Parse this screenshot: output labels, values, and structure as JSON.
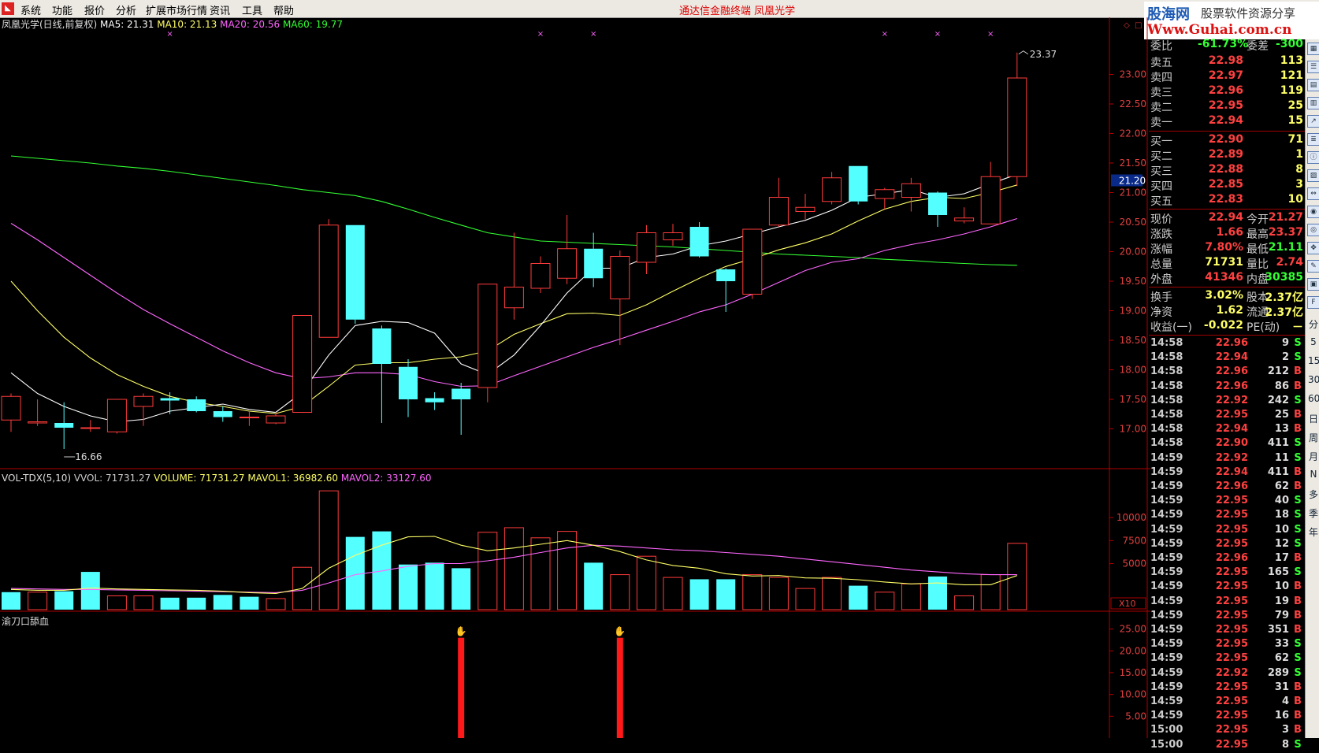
{
  "menubar": {
    "items": [
      "系统",
      "功能",
      "报价",
      "分析",
      "扩展市场行情",
      "资讯",
      "工具",
      "帮助"
    ],
    "center_title": "通达信金融终端    凤凰光学"
  },
  "watermark": {
    "line1": "股海网",
    "line2": "股票软件资源分享",
    "line3": "Www.Guhai.com.cn"
  },
  "chart_data": [
    {
      "type": "candlestick",
      "title": "凤凰光学(日线,前复权)",
      "ma_legend": [
        {
          "name": "MA5",
          "value": "21.31",
          "color": "#ffffff"
        },
        {
          "name": "MA10",
          "value": "21.13",
          "color": "#ffff66"
        },
        {
          "name": "MA20",
          "value": "20.56",
          "color": "#ff66ff"
        },
        {
          "name": "MA60",
          "value": "19.77",
          "color": "#33ff33"
        }
      ],
      "y_ticks": [
        "23.00",
        "22.50",
        "22.00",
        "21.50",
        "21.00",
        "20.50",
        "20.00",
        "19.50",
        "19.00",
        "18.50",
        "18.00",
        "17.50",
        "17.00"
      ],
      "ylim": [
        16.5,
        23.7
      ],
      "current_price_label": "21.20",
      "current_price": 21.2,
      "high_annotation": "23.37",
      "low_annotation": "16.66",
      "candles": [
        {
          "o": 17.15,
          "c": 17.55,
          "h": 17.6,
          "l": 16.95
        },
        {
          "o": 17.1,
          "c": 17.12,
          "h": 17.5,
          "l": 17.05
        },
        {
          "o": 17.1,
          "c": 17.02,
          "h": 17.45,
          "l": 16.66
        },
        {
          "o": 17.02,
          "c": 17.02,
          "h": 17.15,
          "l": 16.95
        },
        {
          "o": 16.95,
          "c": 17.5,
          "h": 17.5,
          "l": 16.92
        },
        {
          "o": 17.38,
          "c": 17.55,
          "h": 17.6,
          "l": 17.05
        },
        {
          "o": 17.52,
          "c": 17.48,
          "h": 17.62,
          "l": 17.25
        },
        {
          "o": 17.5,
          "c": 17.3,
          "h": 17.55,
          "l": 17.28
        },
        {
          "o": 17.3,
          "c": 17.2,
          "h": 17.38,
          "l": 17.12
        },
        {
          "o": 17.2,
          "c": 17.2,
          "h": 17.3,
          "l": 17.05
        },
        {
          "o": 17.1,
          "c": 17.22,
          "h": 17.28,
          "l": 17.08
        },
        {
          "o": 17.28,
          "c": 18.92,
          "h": 18.92,
          "l": 17.28
        },
        {
          "o": 18.55,
          "c": 20.45,
          "h": 20.55,
          "l": 18.55
        },
        {
          "o": 20.45,
          "c": 18.85,
          "h": 20.45,
          "l": 18.78
        },
        {
          "o": 18.7,
          "c": 18.1,
          "h": 18.75,
          "l": 17.1
        },
        {
          "o": 18.05,
          "c": 17.5,
          "h": 18.18,
          "l": 17.2
        },
        {
          "o": 17.52,
          "c": 17.45,
          "h": 17.62,
          "l": 17.32
        },
        {
          "o": 17.68,
          "c": 17.5,
          "h": 17.78,
          "l": 16.9
        },
        {
          "o": 17.7,
          "c": 19.45,
          "h": 19.45,
          "l": 17.45
        },
        {
          "o": 19.05,
          "c": 19.4,
          "h": 20.32,
          "l": 18.85
        },
        {
          "o": 19.38,
          "c": 19.8,
          "h": 19.92,
          "l": 19.3
        },
        {
          "o": 19.55,
          "c": 20.05,
          "h": 20.62,
          "l": 19.45
        },
        {
          "o": 20.05,
          "c": 19.55,
          "h": 20.32,
          "l": 19.4
        },
        {
          "o": 19.2,
          "c": 19.92,
          "h": 20.02,
          "l": 18.42
        },
        {
          "o": 19.82,
          "c": 20.32,
          "h": 20.45,
          "l": 19.62
        },
        {
          "o": 20.2,
          "c": 20.32,
          "h": 20.47,
          "l": 20.1
        },
        {
          "o": 20.42,
          "c": 19.92,
          "h": 20.5,
          "l": 19.9
        },
        {
          "o": 19.7,
          "c": 19.5,
          "h": 19.72,
          "l": 18.98
        },
        {
          "o": 19.28,
          "c": 20.38,
          "h": 20.38,
          "l": 19.2
        },
        {
          "o": 20.45,
          "c": 20.92,
          "h": 21.25,
          "l": 20.42
        },
        {
          "o": 20.68,
          "c": 20.75,
          "h": 20.98,
          "l": 20.55
        },
        {
          "o": 20.85,
          "c": 21.25,
          "h": 21.35,
          "l": 20.8
        },
        {
          "o": 21.45,
          "c": 20.85,
          "h": 21.45,
          "l": 20.8
        },
        {
          "o": 20.9,
          "c": 21.05,
          "h": 21.08,
          "l": 20.72
        },
        {
          "o": 20.92,
          "c": 21.15,
          "h": 21.25,
          "l": 20.68
        },
        {
          "o": 21.0,
          "c": 20.62,
          "h": 21.02,
          "l": 20.42
        },
        {
          "o": 20.52,
          "c": 20.57,
          "h": 20.75,
          "l": 20.48
        },
        {
          "o": 20.47,
          "c": 21.27,
          "h": 21.52,
          "l": 20.47
        },
        {
          "o": 21.27,
          "c": 22.94,
          "h": 23.37,
          "l": 21.11
        }
      ],
      "ma5": [
        17.95,
        17.6,
        17.38,
        17.22,
        17.12,
        17.16,
        17.3,
        17.36,
        17.42,
        17.33,
        17.28,
        17.62,
        18.25,
        18.75,
        18.82,
        18.8,
        18.62,
        18.1,
        17.92,
        18.25,
        18.75,
        19.3,
        19.72,
        19.72,
        19.9,
        19.96,
        20.1,
        20.18,
        20.3,
        20.42,
        20.53,
        20.7,
        20.92,
        20.98,
        21.05,
        20.92,
        20.98,
        21.15,
        21.31
      ],
      "ma10": [
        19.5,
        19.0,
        18.55,
        18.2,
        17.92,
        17.72,
        17.55,
        17.45,
        17.38,
        17.3,
        17.26,
        17.38,
        17.72,
        18.08,
        18.12,
        18.12,
        18.18,
        18.22,
        18.32,
        18.6,
        18.78,
        18.95,
        18.96,
        18.92,
        19.1,
        19.33,
        19.55,
        19.75,
        19.88,
        20.03,
        20.15,
        20.3,
        20.52,
        20.72,
        20.85,
        20.92,
        20.9,
        21.0,
        21.13
      ],
      "ma20": [
        20.48,
        20.2,
        19.9,
        19.6,
        19.3,
        19.02,
        18.78,
        18.55,
        18.32,
        18.12,
        17.95,
        17.85,
        17.88,
        17.95,
        17.95,
        17.92,
        17.8,
        17.72,
        17.73,
        17.9,
        18.06,
        18.22,
        18.38,
        18.52,
        18.67,
        18.82,
        18.98,
        19.1,
        19.28,
        19.48,
        19.68,
        19.82,
        19.88,
        20.02,
        20.12,
        20.2,
        20.3,
        20.42,
        20.56
      ],
      "ma60": [
        21.62,
        21.58,
        21.54,
        21.5,
        21.45,
        21.41,
        21.36,
        21.3,
        21.24,
        21.18,
        21.12,
        21.05,
        21.0,
        20.95,
        20.85,
        20.72,
        20.58,
        20.45,
        20.32,
        20.25,
        20.18,
        20.16,
        20.14,
        20.12,
        20.1,
        20.08,
        20.05,
        20.02,
        19.99,
        19.96,
        19.94,
        19.92,
        19.9,
        19.87,
        19.85,
        19.82,
        19.8,
        19.78,
        19.77
      ],
      "mark_indices": [
        6,
        20,
        22,
        33,
        35,
        37
      ]
    },
    {
      "type": "bar",
      "title": "VOL-TDX(5,10)",
      "legend": [
        {
          "name": "VVOL",
          "value": "71731.27",
          "color": "#cccccc"
        },
        {
          "name": "VOLUME",
          "value": "71731.27",
          "color": "#ffff66"
        },
        {
          "name": "MAVOL1",
          "value": "36982.60",
          "color": "#ffff66"
        },
        {
          "name": "MAVOL2",
          "value": "33127.60",
          "color": "#ff66ff"
        }
      ],
      "y_ticks": [
        "10000",
        "7500",
        "5000"
      ],
      "ylim": [
        0,
        13000
      ],
      "unit_label": "X10",
      "values": [
        1900,
        1900,
        2000,
        4100,
        1500,
        1500,
        1300,
        1300,
        1600,
        1400,
        1200,
        4600,
        12900,
        7900,
        8500,
        4900,
        5100,
        4500,
        8400,
        8900,
        7800,
        8500,
        5100,
        3800,
        5800,
        3500,
        3300,
        3300,
        3800,
        3500,
        2300,
        3500,
        2600,
        1900,
        2800,
        3600,
        1500,
        3800,
        7200
      ],
      "up": [
        false,
        true,
        false,
        false,
        true,
        true,
        false,
        false,
        false,
        false,
        true,
        true,
        true,
        false,
        false,
        false,
        false,
        false,
        true,
        true,
        true,
        true,
        false,
        true,
        true,
        true,
        false,
        false,
        true,
        true,
        true,
        true,
        false,
        true,
        true,
        false,
        true,
        true,
        true
      ],
      "mavol1": [
        2200,
        2100,
        2100,
        2350,
        2250,
        2200,
        2150,
        2100,
        2000,
        1850,
        1750,
        2300,
        4500,
        5900,
        7000,
        7900,
        7950,
        7000,
        6400,
        6700,
        7100,
        7500,
        7000,
        6300,
        5400,
        4800,
        4500,
        3900,
        3650,
        3700,
        3450,
        3400,
        3250,
        3000,
        2800,
        2900,
        2700,
        2700,
        3700
      ],
      "mavol2": [
        2300,
        2250,
        2200,
        2200,
        2150,
        2100,
        2050,
        2000,
        1950,
        1900,
        1850,
        2100,
        2900,
        3800,
        4200,
        4700,
        5000,
        5000,
        5300,
        5700,
        6200,
        6700,
        7000,
        6900,
        6700,
        6500,
        6400,
        6200,
        6000,
        5800,
        5500,
        5200,
        4900,
        4600,
        4300,
        4100,
        3900,
        3800,
        3800
      ]
    },
    {
      "type": "bar",
      "title": "渝刀口舔血",
      "y_ticks": [
        "25.00",
        "20.00",
        "15.00",
        "10.00",
        "5.00"
      ],
      "ylim": [
        0,
        28
      ],
      "signals": [
        {
          "index": 17,
          "value": 23
        },
        {
          "index": 23,
          "value": 23
        }
      ]
    }
  ],
  "quote": {
    "header": {
      "left": "委比",
      "left_value": "-61.73%",
      "right": "委差",
      "right_value": "-300"
    },
    "asks": [
      {
        "label": "卖五",
        "price": "22.98",
        "vol": "113"
      },
      {
        "label": "卖四",
        "price": "22.97",
        "vol": "121"
      },
      {
        "label": "卖三",
        "price": "22.96",
        "vol": "119"
      },
      {
        "label": "卖二",
        "price": "22.95",
        "vol": "25"
      },
      {
        "label": "卖一",
        "price": "22.94",
        "vol": "15"
      }
    ],
    "bids": [
      {
        "label": "买一",
        "price": "22.90",
        "vol": "71"
      },
      {
        "label": "买二",
        "price": "22.89",
        "vol": "1"
      },
      {
        "label": "买三",
        "price": "22.88",
        "vol": "8"
      },
      {
        "label": "买四",
        "price": "22.85",
        "vol": "3"
      },
      {
        "label": "买五",
        "price": "22.83",
        "vol": "10"
      }
    ],
    "stats": [
      {
        "l1": "现价",
        "v1": "22.94",
        "l2": "今开",
        "v2": "21.27",
        "c1": "#ff4040",
        "c2": "#ff4040"
      },
      {
        "l1": "涨跌",
        "v1": "1.66",
        "l2": "最高",
        "v2": "23.37",
        "c1": "#ff4040",
        "c2": "#ff4040"
      },
      {
        "l1": "涨幅",
        "v1": "7.80%",
        "l2": "最低",
        "v2": "21.11",
        "c1": "#ff4040",
        "c2": "#33ff33"
      },
      {
        "l1": "总量",
        "v1": "71731",
        "l2": "量比",
        "v2": "2.74",
        "c1": "#ffff66",
        "c2": "#ff4040"
      },
      {
        "l1": "外盘",
        "v1": "41346",
        "l2": "内盘",
        "v2": "30385",
        "c1": "#ff4040",
        "c2": "#33ff33"
      }
    ],
    "stats2": [
      {
        "l1": "换手",
        "v1": "3.02%",
        "l2": "股本",
        "v2": "2.37亿",
        "c1": "#ffff66",
        "c2": "#ffff66"
      },
      {
        "l1": "净资",
        "v1": "1.62",
        "l2": "流通",
        "v2": "2.37亿",
        "c1": "#ffff66",
        "c2": "#ffff66"
      },
      {
        "l1": "收益(一)",
        "v1": "-0.022",
        "l2": "PE(动)",
        "v2": "－",
        "c1": "#ffff66",
        "c2": "#ffff66"
      }
    ],
    "ticks": [
      {
        "t": "14:58",
        "p": "22.96",
        "v": "9",
        "d": "S"
      },
      {
        "t": "14:58",
        "p": "22.94",
        "v": "2",
        "d": "S"
      },
      {
        "t": "14:58",
        "p": "22.96",
        "v": "212",
        "d": "B"
      },
      {
        "t": "14:58",
        "p": "22.96",
        "v": "86",
        "d": "B"
      },
      {
        "t": "14:58",
        "p": "22.92",
        "v": "242",
        "d": "S"
      },
      {
        "t": "14:58",
        "p": "22.95",
        "v": "25",
        "d": "B"
      },
      {
        "t": "14:58",
        "p": "22.94",
        "v": "13",
        "d": "B"
      },
      {
        "t": "14:58",
        "p": "22.90",
        "v": "411",
        "d": "S"
      },
      {
        "t": "14:59",
        "p": "22.92",
        "v": "11",
        "d": "S"
      },
      {
        "t": "14:59",
        "p": "22.94",
        "v": "411",
        "d": "B"
      },
      {
        "t": "14:59",
        "p": "22.96",
        "v": "62",
        "d": "B"
      },
      {
        "t": "14:59",
        "p": "22.95",
        "v": "40",
        "d": "S"
      },
      {
        "t": "14:59",
        "p": "22.95",
        "v": "18",
        "d": "S"
      },
      {
        "t": "14:59",
        "p": "22.95",
        "v": "10",
        "d": "S"
      },
      {
        "t": "14:59",
        "p": "22.95",
        "v": "12",
        "d": "S"
      },
      {
        "t": "14:59",
        "p": "22.96",
        "v": "17",
        "d": "B"
      },
      {
        "t": "14:59",
        "p": "22.95",
        "v": "165",
        "d": "S"
      },
      {
        "t": "14:59",
        "p": "22.95",
        "v": "10",
        "d": "B"
      },
      {
        "t": "14:59",
        "p": "22.95",
        "v": "19",
        "d": "B"
      },
      {
        "t": "14:59",
        "p": "22.95",
        "v": "79",
        "d": "B"
      },
      {
        "t": "14:59",
        "p": "22.95",
        "v": "351",
        "d": "B"
      },
      {
        "t": "14:59",
        "p": "22.95",
        "v": "33",
        "d": "S"
      },
      {
        "t": "14:59",
        "p": "22.95",
        "v": "62",
        "d": "S"
      },
      {
        "t": "14:59",
        "p": "22.92",
        "v": "289",
        "d": "S"
      },
      {
        "t": "14:59",
        "p": "22.95",
        "v": "31",
        "d": "B"
      },
      {
        "t": "14:59",
        "p": "22.95",
        "v": "4",
        "d": "B"
      },
      {
        "t": "14:59",
        "p": "22.95",
        "v": "16",
        "d": "B"
      },
      {
        "t": "15:00",
        "p": "22.95",
        "v": "3",
        "d": "B"
      },
      {
        "t": "15:00",
        "p": "22.95",
        "v": "8",
        "d": "S"
      }
    ]
  },
  "sidebar": {
    "icons": [
      "grid-icon",
      "list-icon",
      "table-icon",
      "bar-icon",
      "line-icon",
      "news-icon",
      "info-icon",
      "chart-icon",
      "arrow-icon",
      "rss-icon",
      "target-icon",
      "move-icon",
      "pen-icon",
      "layout-icon",
      "f10-icon"
    ],
    "labels": [
      "分",
      "5",
      "15",
      "30",
      "60",
      "日",
      "周",
      "月",
      "N",
      "多",
      "季",
      "年"
    ]
  },
  "colors": {
    "up": "#ff3b3b",
    "down": "#54ffff",
    "axis": "#b00000",
    "text_axis": "#e04040"
  }
}
